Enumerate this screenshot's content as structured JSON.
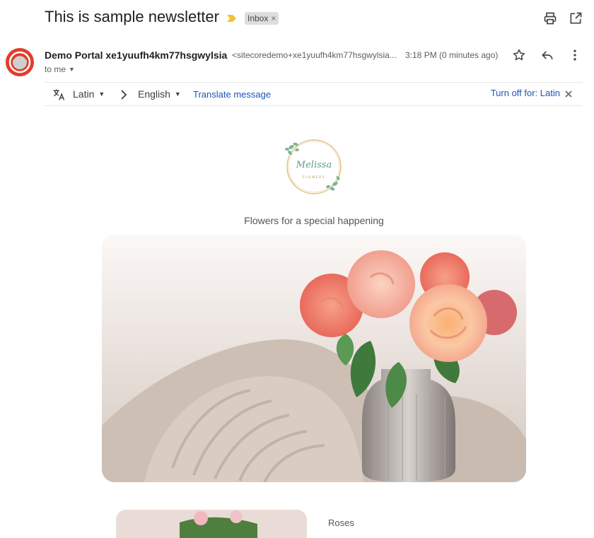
{
  "subject": {
    "title": "This is sample newsletter",
    "label": "Inbox",
    "label_close": "×"
  },
  "sender": {
    "name": "Demo Portal xe1yuufh4km77hsgwylsia",
    "email": "<sitecoredemo+xe1yuufh4km77hsgwylsia...",
    "time": "3:18 PM (0 minutes ago)",
    "recipient": "to me"
  },
  "translate": {
    "from_lang": "Latin",
    "to_lang": "English",
    "translate_link": "Translate message",
    "turn_off": "Turn off for: Latin"
  },
  "newsletter": {
    "logo_script": "Melissa",
    "logo_sub": "FLOWERS",
    "tagline": "Flowers for a special happening",
    "product_title": "Roses"
  },
  "colors": {
    "accent_link": "#1a56b8",
    "importance": "#f2c230",
    "avatar": "#e43c2b",
    "label_chip": "#dddddd"
  },
  "icons": [
    "importance-marker-icon",
    "print-icon",
    "open-in-new-window-icon",
    "star-icon",
    "reply-icon",
    "more-vert-icon",
    "translate-icon",
    "chevron-right-icon",
    "close-icon"
  ]
}
